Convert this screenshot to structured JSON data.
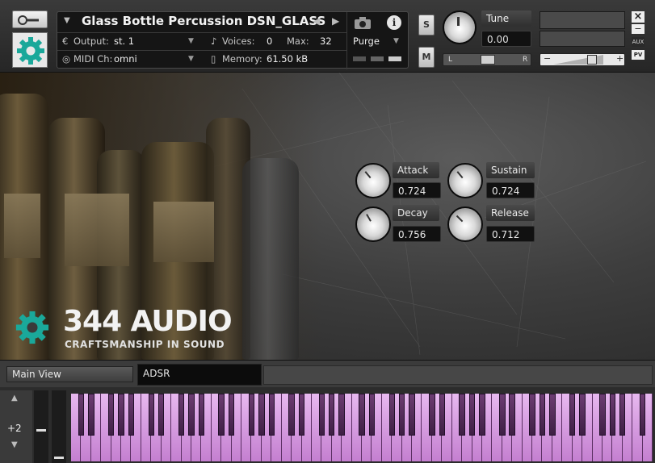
{
  "header": {
    "instrument_name": "Glass Bottle Percussion DSN_GLASS",
    "output_label": "Output:",
    "output_value": "st. 1",
    "voices_label": "Voices:",
    "voices_value": "0",
    "max_label": "Max:",
    "max_value": "32",
    "purge_label": "Purge",
    "midi_label": "MIDI Ch:",
    "midi_value": "omni",
    "memory_label": "Memory:",
    "memory_value": "61.50 kB",
    "solo_label": "S",
    "mute_label": "M",
    "tune_label": "Tune",
    "tune_value": "0.00",
    "pan_left": "L",
    "pan_right": "R",
    "vol_minus": "−",
    "vol_plus": "+",
    "aux_label": "AUX",
    "pv_label": "PV",
    "close_glyph": "×",
    "minimize_glyph": "−"
  },
  "panel": {
    "brand_name": "344 AUDIO",
    "brand_tagline": "CRAFTSMANSHIP IN SOUND",
    "knobs": [
      {
        "label": "Attack",
        "value": "0.724"
      },
      {
        "label": "Sustain",
        "value": "0.724"
      },
      {
        "label": "Decay",
        "value": "0.756"
      },
      {
        "label": "Release",
        "value": "0.712"
      }
    ]
  },
  "tabs": {
    "main_view": "Main View",
    "adsr": "ADSR"
  },
  "keyboard": {
    "octave_value": "+2",
    "up_glyph": "▲",
    "down_glyph": "▼"
  },
  "colors": {
    "key_white": "#d79ae2",
    "key_black": "#4a2550",
    "gear_teal": "#1aa89a"
  }
}
